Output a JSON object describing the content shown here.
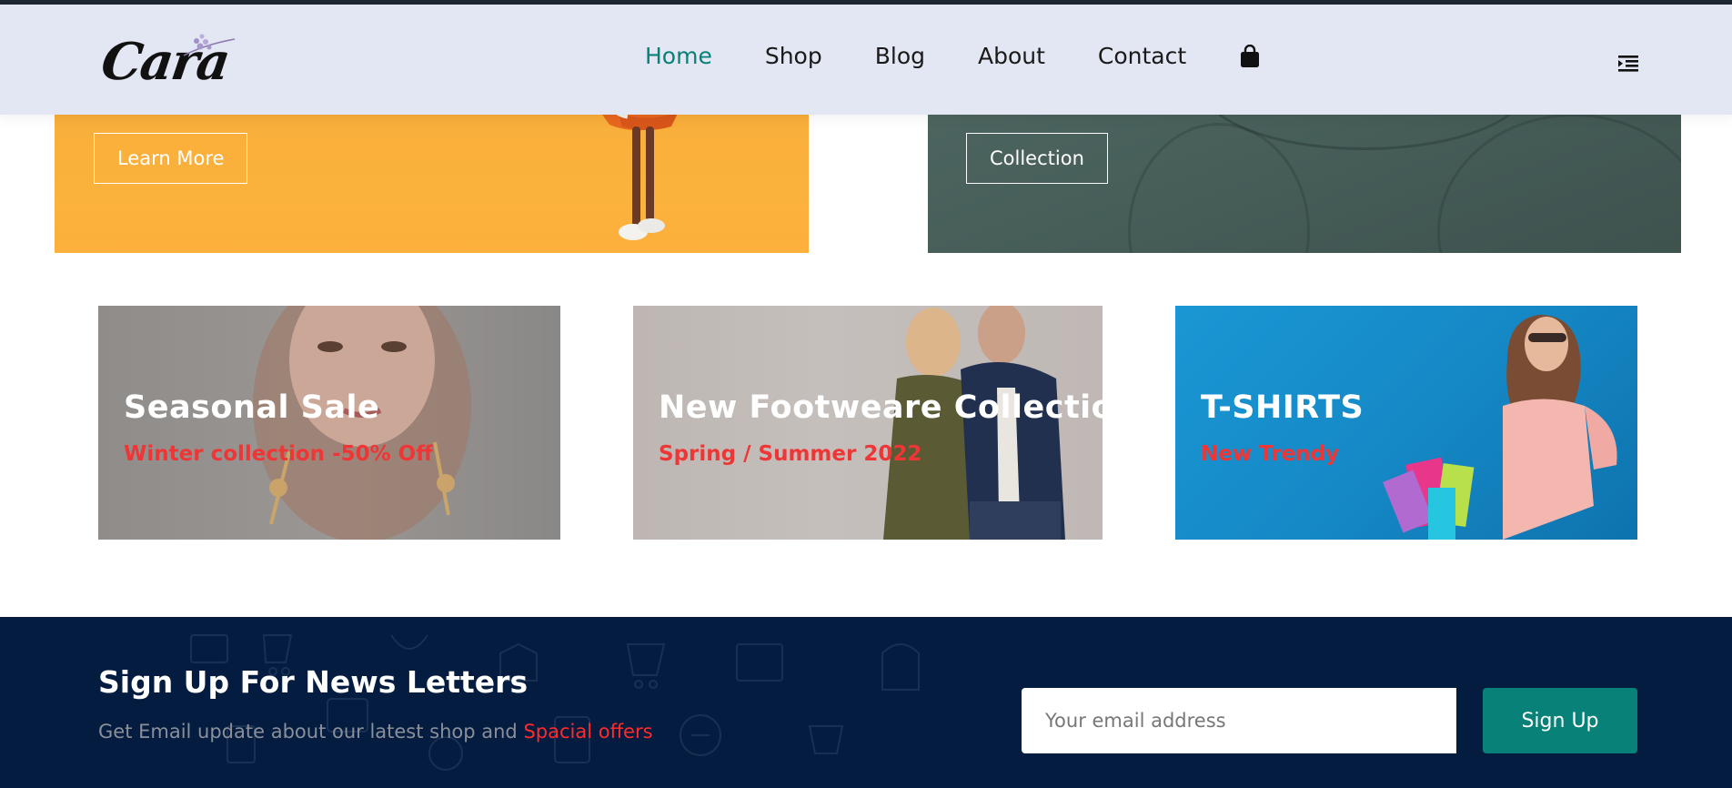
{
  "header": {
    "logo_alt": "Cara",
    "nav": [
      {
        "label": "Home",
        "active": true
      },
      {
        "label": "Shop",
        "active": false
      },
      {
        "label": "Blog",
        "active": false
      },
      {
        "label": "About",
        "active": false
      },
      {
        "label": "Contact",
        "active": false
      }
    ],
    "icons": {
      "cart": "shopping-bag-icon",
      "menu": "menu-icon"
    }
  },
  "banners": {
    "left": {
      "button_label": "Learn More"
    },
    "right": {
      "button_label": "Collection"
    }
  },
  "small_banners": [
    {
      "title": "Seasonal Sale",
      "subtitle": "Winter collection -50% Off"
    },
    {
      "title": "New Footweare Collection",
      "subtitle": "Spring / Summer 2022"
    },
    {
      "title": "T-SHIRTS",
      "subtitle": "New Trendy"
    }
  ],
  "newsletter": {
    "title": "Sign Up For News Letters",
    "desc_text": "Get Email update about our latest shop and ",
    "desc_highlight": "Spacial offers",
    "email_placeholder": "Your email address",
    "button_label": "Sign Up"
  },
  "colors": {
    "accent": "#088178",
    "header_bg": "#e3e6f3",
    "newsletter_bg": "#041c3f",
    "highlight_red": "#ff2b2b",
    "subtitle_red": "#ef3636"
  }
}
